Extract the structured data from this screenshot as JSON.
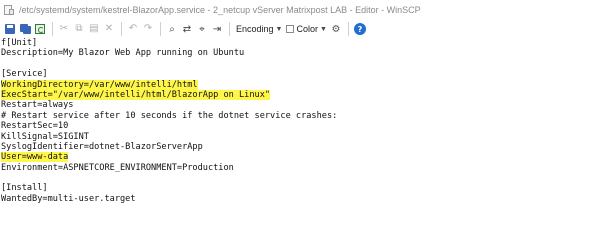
{
  "window": {
    "title": "/etc/systemd/system/kestrel-BlazorApp.service - 2_netcup vServer Matrixpost LAB - Editor - WinSCP"
  },
  "toolbar": {
    "encoding_label": "Encoding",
    "color_label": "Color",
    "help_label": "?",
    "icons": [
      "save-icon",
      "save-all-icon",
      "reload-icon",
      "cut-icon",
      "copy-icon",
      "paste-icon",
      "delete-icon",
      "undo-icon",
      "redo-icon",
      "find-icon",
      "replace-icon",
      "find-next-icon",
      "go-to-line-icon",
      "encoding-dropdown",
      "color-dropdown",
      "preferences-gear-icon",
      "help-icon"
    ]
  },
  "colors": {
    "highlight": "#fff64a",
    "text": "#111111",
    "help": "#1f6fd0"
  },
  "editor": {
    "lines": [
      {
        "text": "f[Unit]",
        "highlight": false
      },
      {
        "text": "Description=My Blazor Web App running on Ubuntu",
        "highlight": false
      },
      {
        "text": "",
        "highlight": false
      },
      {
        "text": "[Service]",
        "highlight": false
      },
      {
        "text": "WorkingDirectory=/var/www/intelli/html",
        "highlight": true
      },
      {
        "text": "ExecStart=\"/var/www/intelli/html/BlazorApp on Linux\"",
        "highlight": true
      },
      {
        "text": "Restart=always",
        "highlight": false
      },
      {
        "text": "# Restart service after 10 seconds if the dotnet service crashes:",
        "highlight": false
      },
      {
        "text": "RestartSec=10",
        "highlight": false
      },
      {
        "text": "KillSignal=SIGINT",
        "highlight": false
      },
      {
        "text": "SyslogIdentifier=dotnet-BlazorServerApp",
        "highlight": false
      },
      {
        "text": "User=www-data",
        "highlight": true
      },
      {
        "text": "Environment=ASPNETCORE_ENVIRONMENT=Production",
        "highlight": false
      },
      {
        "text": "",
        "highlight": false
      },
      {
        "text": "[Install]",
        "highlight": false
      },
      {
        "text": "WantedBy=multi-user.target",
        "highlight": false
      }
    ]
  }
}
